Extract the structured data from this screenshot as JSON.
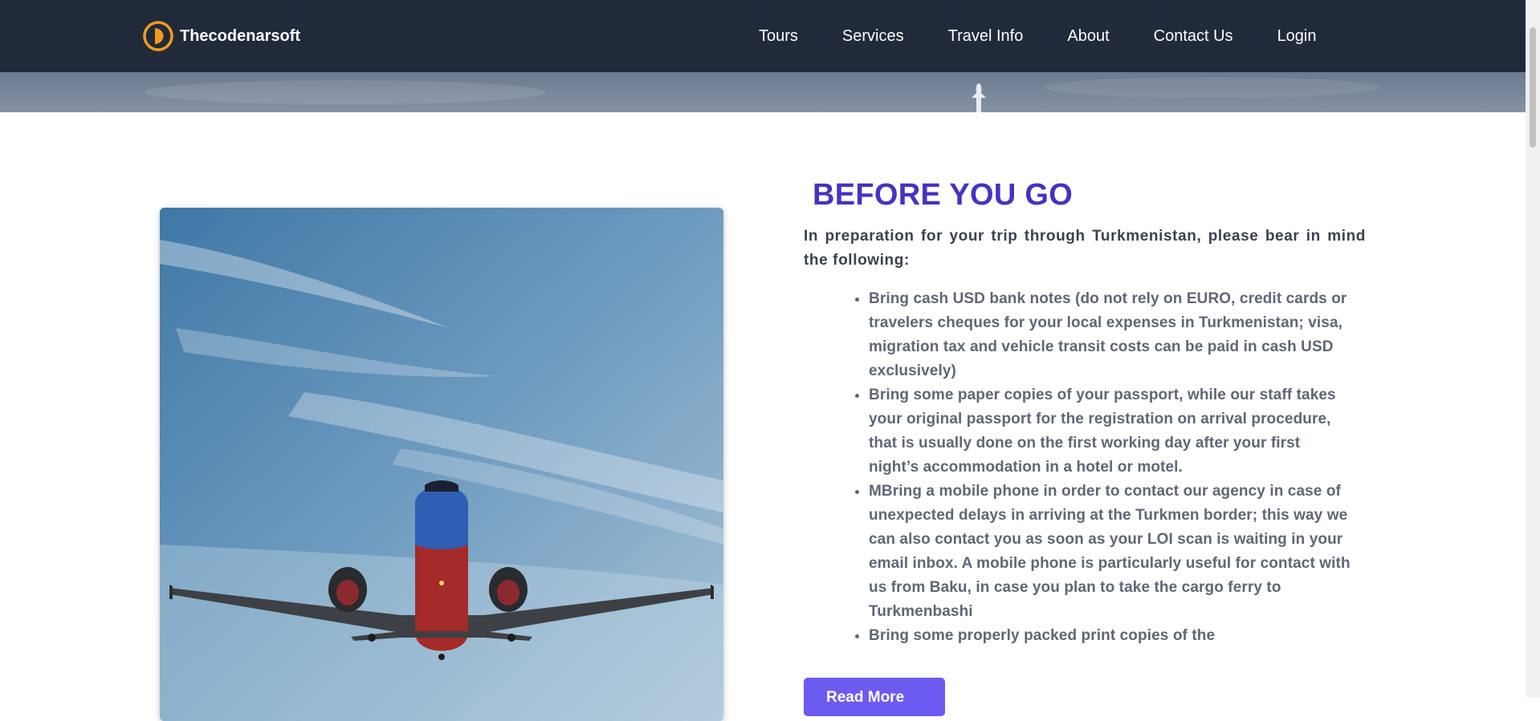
{
  "nav": {
    "brand": "Thecodenarsoft",
    "links": [
      "Tours",
      "Services",
      "Travel Info",
      "About",
      "Contact Us",
      "Login"
    ]
  },
  "colors": {
    "navbar": "#212a3a",
    "heading": "#4433c4",
    "button": "#6b5bf0",
    "logo": "#f39a1e"
  },
  "section": {
    "heading": "BEFORE YOU GO",
    "intro": "In preparation for your trip through Turkmenistan, please bear in mind the following:",
    "bullets": [
      "Bring cash USD bank notes (do not rely on EURO, credit cards or travelers cheques for your local expenses in Turkmenistan; visa, migration tax and vehicle transit costs can be paid in cash USD exclusively)",
      "Bring some paper copies of your passport, while our staff takes your original passport for the registration on arrival procedure, that is usually done on the first working day after your first night’s accommodation in a hotel or motel.",
      "MBring a mobile phone in order to contact our agency in case of unexpected delays in arriving at the Turkmen border; this way we can also contact you as soon as your LOI scan is waiting in your email inbox. A mobile phone is particularly useful for contact with us from Baku, in case you plan to take the cargo ferry to Turkmenbashi",
      "Bring some properly packed print copies of the"
    ],
    "button_label": "Read More"
  },
  "icons": {
    "logo": "brand-logo-icon"
  }
}
